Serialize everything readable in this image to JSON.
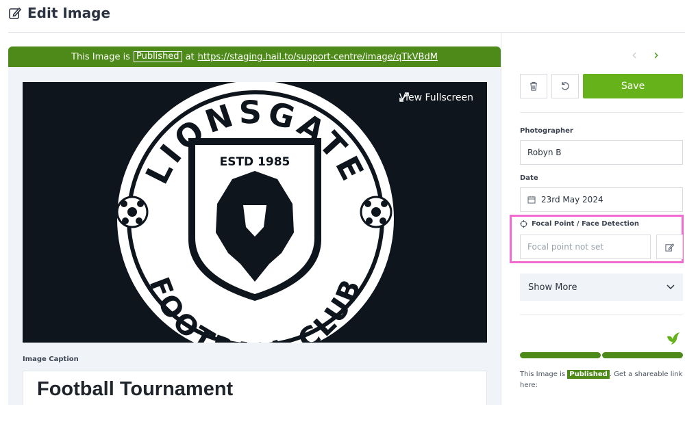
{
  "page": {
    "title": "Edit Image"
  },
  "image": {
    "status_prefix": "This Image is",
    "status": "Published",
    "at_label": "at",
    "url": "https://staging.hail.to/support-centre/image/qTkVBdM",
    "fullscreen_label": "View Fullscreen",
    "logo_text": {
      "top": "LIONSGATE",
      "estd": "ESTD 1985",
      "bottom": "FOOTBALL CLUB"
    },
    "caption_label": "Image Caption",
    "caption": "Football Tournament"
  },
  "sidebar": {
    "save_label": "Save",
    "photographer": {
      "label": "Photographer",
      "value": "Robyn B"
    },
    "date": {
      "label": "Date",
      "value": "23rd May 2024"
    },
    "focal": {
      "label": "Focal Point / Face Detection",
      "placeholder": "Focal point not set"
    },
    "show_more_label": "Show More",
    "share_prefix": "This Image is",
    "share_status": "Published",
    "share_suffix": ". Get a shareable link here:"
  },
  "colors": {
    "brand_green": "#4e8a1a",
    "save_green": "#66b21a",
    "highlight": "#f36bd0"
  },
  "icons": [
    "edit-icon",
    "expand-icon",
    "trash-icon",
    "undo-icon",
    "chevron-left-icon",
    "chevron-right-icon",
    "calendar-icon",
    "crosshair-icon",
    "chevron-down-icon",
    "bird-icon"
  ]
}
